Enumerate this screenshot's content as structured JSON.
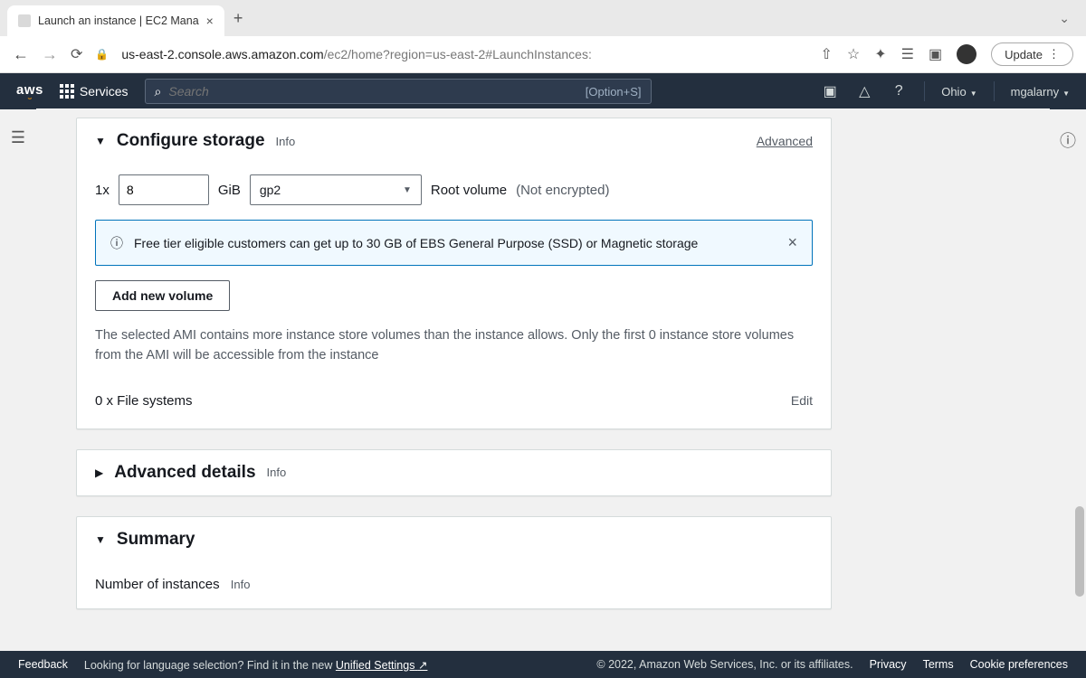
{
  "browser": {
    "tab_title": "Launch an instance | EC2 Mana",
    "url_host": "us-east-2.console.aws.amazon.com",
    "url_path": "/ec2/home?region=us-east-2#LaunchInstances:",
    "update_label": "Update"
  },
  "aws_nav": {
    "logo": "aws",
    "services_label": "Services",
    "search_placeholder": "Search",
    "search_shortcut": "[Option+S]",
    "region": "Ohio",
    "user": "mgalarny"
  },
  "storage": {
    "title": "Configure storage",
    "info": "Info",
    "advanced": "Advanced",
    "count_prefix": "1x",
    "size_value": "8",
    "size_unit": "GiB",
    "type_value": "gp2",
    "root_label": "Root volume",
    "enc_label": "(Not encrypted)",
    "banner_text": "Free tier eligible customers can get up to 30 GB of EBS General Purpose (SSD) or Magnetic storage",
    "add_volume_label": "Add new volume",
    "ami_note": "The selected AMI contains more instance store volumes than the instance allows. Only the first 0 instance store volumes from the AMI will be accessible from the instance",
    "fs_label": "0 x File systems",
    "edit_label": "Edit"
  },
  "advanced_details": {
    "title": "Advanced details",
    "info": "Info"
  },
  "summary": {
    "title": "Summary",
    "num_instances_label": "Number of instances",
    "info": "Info"
  },
  "footer": {
    "feedback": "Feedback",
    "lang_prefix": "Looking for language selection? Find it in the new",
    "unified": "Unified Settings",
    "copyright": "© 2022, Amazon Web Services, Inc. or its affiliates.",
    "privacy": "Privacy",
    "terms": "Terms",
    "cookies": "Cookie preferences"
  }
}
